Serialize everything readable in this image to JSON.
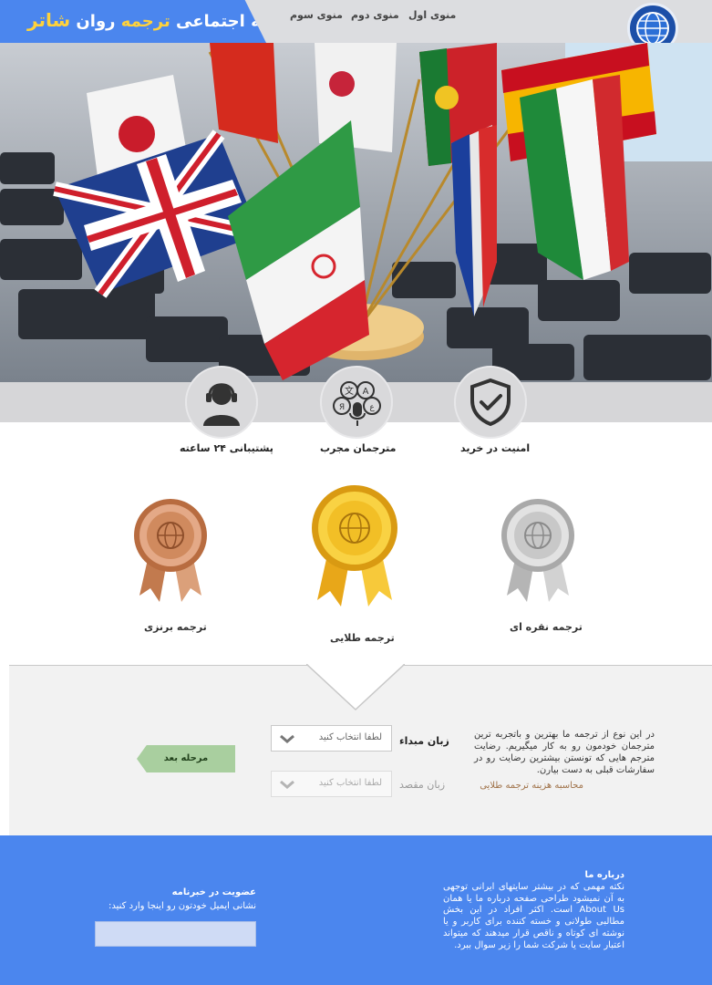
{
  "brand": {
    "part1": "شبکه اجتماعی",
    "part2": "ترجمه",
    "part3": "روان",
    "part4": "شاتر"
  },
  "menu": [
    "منوی اول",
    "منوی دوم",
    "منوی سوم"
  ],
  "features": [
    {
      "label": "امنیت در خرید",
      "icon": "shield-check-icon"
    },
    {
      "label": "مترجمان مجرب",
      "icon": "translator-icon"
    },
    {
      "label": "پشتیبانی ۲۴ ساعته",
      "icon": "support-agent-icon"
    }
  ],
  "medals": [
    {
      "label": "ترجمه نقره ای",
      "icon": "silver-medal-icon",
      "color": "#c9c9c9"
    },
    {
      "label": "ترجمه طلایی",
      "icon": "gold-medal-icon",
      "color": "#f2bf26"
    },
    {
      "label": "ترجمه برنزی",
      "icon": "bronze-medal-icon",
      "color": "#d08a5e"
    }
  ],
  "form": {
    "source_label": "زبان مبداء",
    "source_value": "لطفا انتخاب کنید",
    "target_label": "زبان مقصد",
    "target_value": "لطفا انتخاب کنید",
    "next_label": "مرحله بعد",
    "description": "در این نوع از ترجمه ما بهترین و باتجربه ترین مترجمان خودمون رو به کار میگیریم. رضایت مترجم هایی که تونستن بیشترین رضایت رو در سفارشات قبلی به دست بیارن.",
    "calc_link": "محاسبه هزینه ترجمه طلایی"
  },
  "footer": {
    "about_title": "درباره ما",
    "about_body": "نکته مهمی که در بیشتر سایتهای ایرانی توجهی به آن نمیشود طراحی صفحه درباره ما یا همان About Us است. اکثر افراد در این بخش مطالبی طولانی و خسته کننده برای کاربر و یا نوشته ای کوتاه و ناقص قرار میدهند که میتواند اعتبار سایت یا شرکت شما را زیر سوال ببرد.",
    "newsletter_title": "عضویت در خبرنامه",
    "newsletter_sub": "نشانی ایمیل خودتون رو اینجا وارد کنید:",
    "email_value": ""
  },
  "colors": {
    "accent": "#4b86ee",
    "gold": "#f2bf26",
    "silver": "#c9c9c9",
    "bronze": "#d08a5e",
    "next_button": "#a9cf9f",
    "link": "#a0734a"
  }
}
